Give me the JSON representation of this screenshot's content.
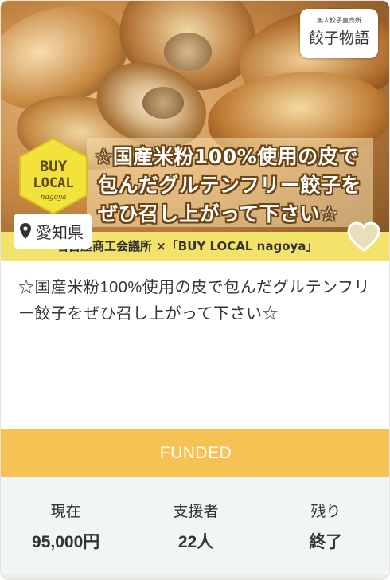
{
  "hero": {
    "headline_line1": "☆国産米粉100%使用の皮で",
    "headline_line2": "包んだグルテンフリー餃子を",
    "headline_line3": "ぜひ召し上がって下さい☆",
    "buy_local_line1": "BUY",
    "buy_local_line2": "LOCAL",
    "buy_local_line3": "nagoya",
    "brand_small": "無人餃子直売所",
    "brand_main": "餃子物語",
    "footer_text": "名古屋商工会議所 ×「BUY LOCAL nagoya」",
    "location": "愛知県"
  },
  "title": "☆国産米粉100%使用の皮で包んだグルテンフリー餃子をぜひ召し上がって下さい☆",
  "status": {
    "label": "FUNDED"
  },
  "stats": [
    {
      "label": "現在",
      "value": "95,000円"
    },
    {
      "label": "支援者",
      "value": "22人"
    },
    {
      "label": "残り",
      "value": "終了"
    }
  ],
  "colors": {
    "status_bar": "#f7c254",
    "stats_bg": "#f2f5f6",
    "footer_strip": "#f3e36a",
    "heart_fill": "#e8e0b8"
  },
  "icons": {
    "location": "map-pin-icon",
    "favorite": "heart-icon"
  }
}
